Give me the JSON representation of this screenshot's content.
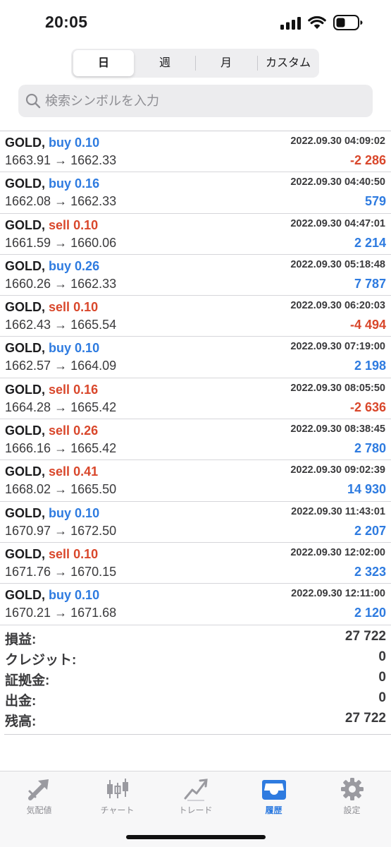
{
  "status_bar": {
    "time": "20:05"
  },
  "period_tabs": [
    "日",
    "週",
    "月",
    "カスタム"
  ],
  "active_period_index": 0,
  "search": {
    "placeholder": "検索シンボルを入力",
    "value": ""
  },
  "trades": [
    {
      "symbol": "GOLD,",
      "type": "buy",
      "volume": "0.10",
      "datetime": "2022.09.30 04:09:02",
      "prices": "1663.91 → 1662.33",
      "profit": "-2 286"
    },
    {
      "symbol": "GOLD,",
      "type": "buy",
      "volume": "0.16",
      "datetime": "2022.09.30 04:40:50",
      "prices": "1662.08 → 1662.33",
      "profit": "579"
    },
    {
      "symbol": "GOLD,",
      "type": "sell",
      "volume": "0.10",
      "datetime": "2022.09.30 04:47:01",
      "prices": "1661.59 → 1660.06",
      "profit": "2 214"
    },
    {
      "symbol": "GOLD,",
      "type": "buy",
      "volume": "0.26",
      "datetime": "2022.09.30 05:18:48",
      "prices": "1660.26 → 1662.33",
      "profit": "7 787"
    },
    {
      "symbol": "GOLD,",
      "type": "sell",
      "volume": "0.10",
      "datetime": "2022.09.30 06:20:03",
      "prices": "1662.43 → 1665.54",
      "profit": "-4 494"
    },
    {
      "symbol": "GOLD,",
      "type": "buy",
      "volume": "0.10",
      "datetime": "2022.09.30 07:19:00",
      "prices": "1662.57 → 1664.09",
      "profit": "2 198"
    },
    {
      "symbol": "GOLD,",
      "type": "sell",
      "volume": "0.16",
      "datetime": "2022.09.30 08:05:50",
      "prices": "1664.28 → 1665.42",
      "profit": "-2 636"
    },
    {
      "symbol": "GOLD,",
      "type": "sell",
      "volume": "0.26",
      "datetime": "2022.09.30 08:38:45",
      "prices": "1666.16 → 1665.42",
      "profit": "2 780"
    },
    {
      "symbol": "GOLD,",
      "type": "sell",
      "volume": "0.41",
      "datetime": "2022.09.30 09:02:39",
      "prices": "1668.02 → 1665.50",
      "profit": "14 930"
    },
    {
      "symbol": "GOLD,",
      "type": "buy",
      "volume": "0.10",
      "datetime": "2022.09.30 11:43:01",
      "prices": "1670.97 → 1672.50",
      "profit": "2 207"
    },
    {
      "symbol": "GOLD,",
      "type": "sell",
      "volume": "0.10",
      "datetime": "2022.09.30 12:02:00",
      "prices": "1671.76 → 1670.15",
      "profit": "2 323"
    },
    {
      "symbol": "GOLD,",
      "type": "buy",
      "volume": "0.10",
      "datetime": "2022.09.30 12:11:00",
      "prices": "1670.21 → 1671.68",
      "profit": "2 120"
    }
  ],
  "summary": [
    {
      "label": "損益:",
      "value": "27 722"
    },
    {
      "label": "クレジット:",
      "value": "0"
    },
    {
      "label": "証拠金:",
      "value": "0"
    },
    {
      "label": "出金:",
      "value": "0"
    },
    {
      "label": "残高:",
      "value": "27 722"
    }
  ],
  "tabbar": [
    {
      "label": "気配値",
      "icon": "quotes-arrow-icon"
    },
    {
      "label": "チャート",
      "icon": "candlestick-icon"
    },
    {
      "label": "トレード",
      "icon": "trade-line-icon"
    },
    {
      "label": "履歴",
      "icon": "history-inbox-icon"
    },
    {
      "label": "設定",
      "icon": "gear-icon"
    }
  ],
  "active_tab_index": 3,
  "colors": {
    "buy": "#2e7be0",
    "sell": "#d9472b",
    "positive": "#2e7be0",
    "negative": "#d9472b",
    "accent": "#2e7be0",
    "inactive": "#8e8e93"
  }
}
